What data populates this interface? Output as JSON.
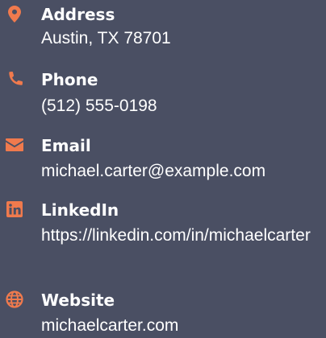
{
  "accent_color": "#f07a4d",
  "background_color": "#4a4f63",
  "items": [
    {
      "icon": "map-pin-icon",
      "label": "Address",
      "value": "Austin, TX 78701"
    },
    {
      "icon": "phone-icon",
      "label": "Phone",
      "value": "(512) 555-0198"
    },
    {
      "icon": "envelope-icon",
      "label": "Email",
      "value": "michael.carter@example.com"
    },
    {
      "icon": "linkedin-icon",
      "label": "LinkedIn",
      "value": "https://linkedin.com/in/michaelcarter"
    },
    {
      "icon": "globe-icon",
      "label": "Website",
      "value": "michaelcarter.com"
    }
  ]
}
